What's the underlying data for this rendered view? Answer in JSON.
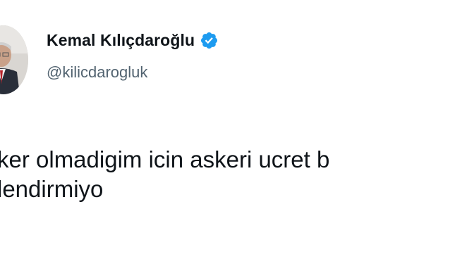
{
  "tweet": {
    "author": {
      "display_name": "Kemal Kılıçdaroğlu",
      "handle": "@kilicdarogluk",
      "verified": true,
      "verified_icon": "verified-badge-icon",
      "verified_color": "#1d9bf0"
    },
    "text_lines": [
      "ker olmadigim icin askeri ucret b",
      "lendirmiyo"
    ]
  }
}
